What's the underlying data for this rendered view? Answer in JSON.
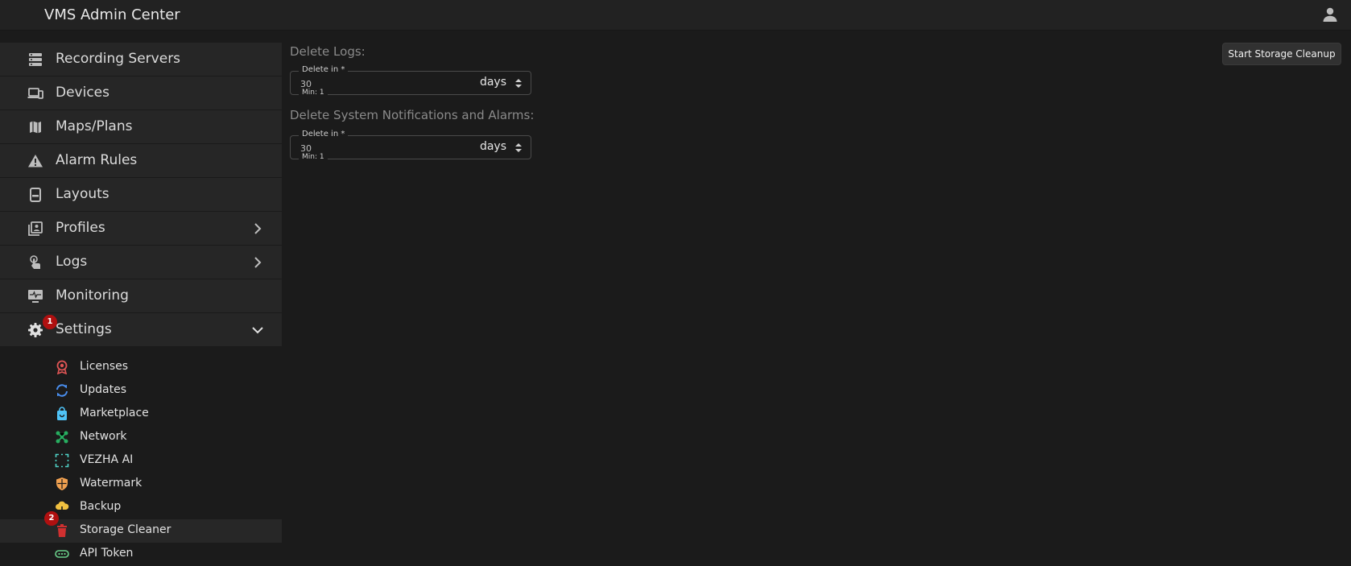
{
  "header": {
    "title": "VMS Admin Center",
    "user_icon": "user-icon"
  },
  "sidebar": {
    "items": [
      {
        "label": "Recording Servers",
        "icon": "server-icon"
      },
      {
        "label": "Devices",
        "icon": "devices-icon"
      },
      {
        "label": "Maps/Plans",
        "icon": "map-icon"
      },
      {
        "label": "Alarm Rules",
        "icon": "warning-icon"
      },
      {
        "label": "Layouts",
        "icon": "layout-icon"
      },
      {
        "label": "Profiles",
        "icon": "profiles-icon",
        "expandable": true
      },
      {
        "label": "Logs",
        "icon": "touch-icon",
        "expandable": true
      },
      {
        "label": "Monitoring",
        "icon": "monitor-icon"
      },
      {
        "label": "Settings",
        "icon": "gear-icon",
        "expanded": true,
        "badge": "1"
      }
    ],
    "settings_items": [
      {
        "label": "Licenses",
        "icon": "license-icon",
        "color": "#e05555"
      },
      {
        "label": "Updates",
        "icon": "sync-icon",
        "color": "#4a8ff0"
      },
      {
        "label": "Marketplace",
        "icon": "shopping-bag-icon",
        "color": "#4fc3f7"
      },
      {
        "label": "Network",
        "icon": "network-icon",
        "color": "#27ae60"
      },
      {
        "label": "VEZHA AI",
        "icon": "ai-scan-icon",
        "color": "#4fd1c5"
      },
      {
        "label": "Watermark",
        "icon": "shield-icon",
        "color": "#f0a050"
      },
      {
        "label": "Backup",
        "icon": "cloud-download-icon",
        "color": "#f0c040"
      },
      {
        "label": "Storage Cleaner",
        "icon": "trash-icon",
        "color": "#d03030",
        "active": true,
        "badge": "2"
      },
      {
        "label": "API Token",
        "icon": "token-icon",
        "color": "#6bd08b"
      }
    ]
  },
  "main": {
    "action_button": "Start Storage Cleanup",
    "sections": [
      {
        "title": "Delete Logs:",
        "field_label": "Delete in *",
        "value": "30",
        "unit": "days",
        "helper": "Min: 1"
      },
      {
        "title": "Delete System Notifications and Alarms:",
        "field_label": "Delete in *",
        "value": "30",
        "unit": "days",
        "helper": "Min: 1"
      }
    ]
  },
  "colors": {
    "background": "#1b1b1b",
    "sidebar_item": "#262626",
    "badge": "#b01010"
  }
}
